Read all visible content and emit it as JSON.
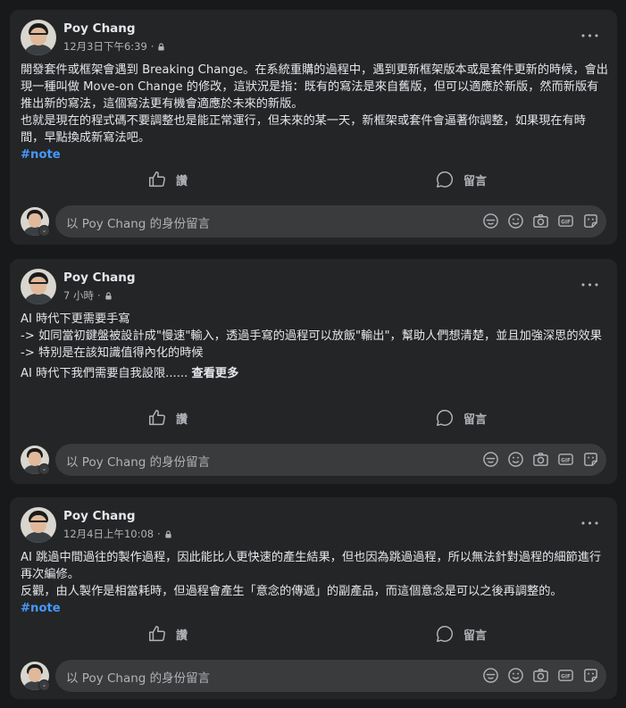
{
  "author": "Poy Chang",
  "comment_placeholder": "以 Poy Chang 的身份留言",
  "like_label": "讚",
  "comment_label": "留言",
  "more_label": "•••",
  "posts": [
    {
      "time": "12月3日下午6:39",
      "paragraphs": [
        "開發套件或框架會遇到 Breaking Change。在系統重購的過程中，遇到更新框架版本或是套件更新的時候，會出現一種叫做 Move-on Change 的修改，這狀況是指：既有的寫法是來自舊版，但可以適應於新版，然而新版有推出新的寫法，這個寫法更有機會適應於未來的新版。",
        "也就是現在的程式碼不要調整也是能正常運行，但未來的某一天，新框架或套件會逼著你調整，如果現在有時間，早點換成新寫法吧。"
      ],
      "tag": "#note"
    },
    {
      "time": "7 小時",
      "paragraphs": [
        "AI 時代下更需要手寫",
        "-> 如同當初鍵盤被設計成\"慢速\"輸入，透過手寫的過程可以放飯\"輸出\"，幫助人們想清楚，並且加強深思的效果",
        "-> 特別是在該知識值得內化的時候"
      ],
      "last_line": "AI 時代下我們需要自我設限......",
      "see_more": "查看更多"
    },
    {
      "time": "12月4日上午10:08",
      "paragraphs": [
        "AI 跳過中間過往的製作過程，因此能比人更快速的產生結果，但也因為跳過過程，所以無法針對過程的細節進行再次編修。",
        "反觀，由人製作是相當耗時，但過程會產生「意念的傳遞」的副產品，而這個意念是可以之後再調整的。"
      ],
      "tag": "#note"
    }
  ]
}
